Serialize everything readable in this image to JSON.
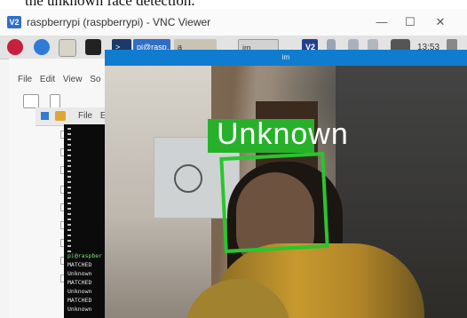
{
  "caption": {
    "text": "the unknown face detection."
  },
  "vnc": {
    "title": "raspberrypi (raspberrypi) - VNC Viewer",
    "logo": "V2",
    "controls": [
      "—",
      "☐",
      "✕"
    ]
  },
  "taskbar": {
    "tasks": [
      {
        "label": ">_",
        "state": "inactive"
      },
      {
        "label": "pi@rasp…",
        "state": "active"
      },
      {
        "label": "a",
        "state": "inactive"
      },
      {
        "label": "im",
        "state": "inactive"
      }
    ],
    "tray_logo": "V2",
    "clock": "13:53",
    "icons": [
      "raspberry-icon",
      "globe-icon",
      "folder-icon",
      "terminal-icon",
      "bluetooth-icon",
      "wifi-icon",
      "volume-icon",
      "cpu-icon",
      "eject-icon"
    ]
  },
  "file_manager": {
    "menu": [
      "File",
      "Edit",
      "View",
      "So"
    ],
    "inner_menu": [
      "File",
      "Edit"
    ]
  },
  "terminal": {
    "prompt": "pi@raspber",
    "lines": [
      "MATCHED",
      "Unknown",
      "MATCHED",
      "Unknown",
      "MATCHED",
      "Unknown"
    ]
  },
  "camera": {
    "title": "im",
    "detection_label": "Unknown",
    "colors": {
      "box": "#2ac52e",
      "title_bar": "#0f7cd0"
    }
  }
}
